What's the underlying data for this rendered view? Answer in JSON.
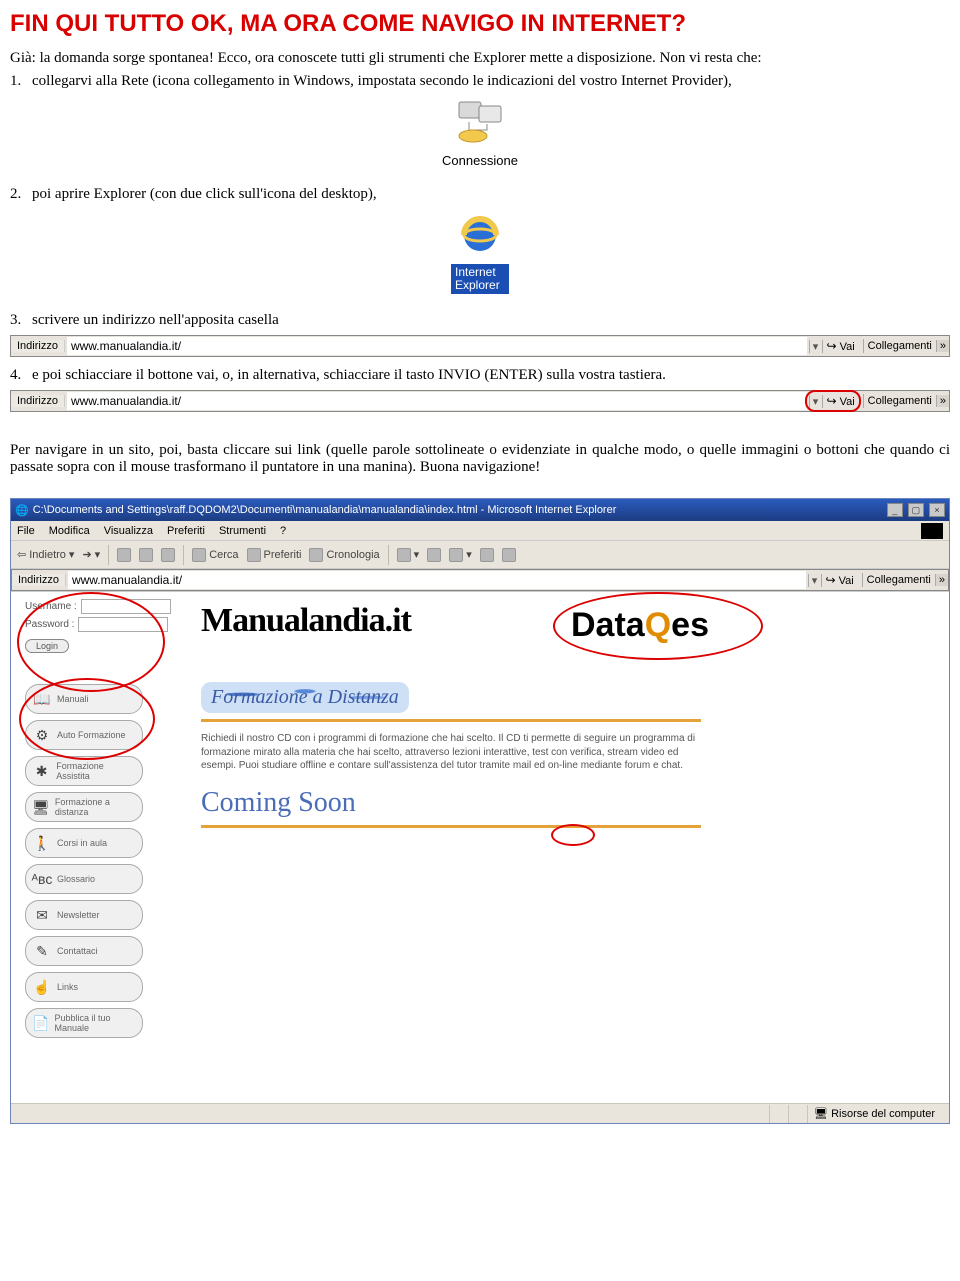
{
  "title": "FIN QUI TUTTO OK, MA ORA COME NAVIGO IN INTERNET?",
  "intro": "Già: la domanda sorge spontanea! Ecco, ora conoscete tutti gli strumenti che Explorer mette a disposizione. Non vi resta che:",
  "steps": {
    "n1": "1.",
    "s1": "collegarvi alla Rete (icona collegamento in Windows, impostata secondo le indicazioni del vostro Internet Provider),",
    "n2": "2.",
    "s2": "poi aprire Explorer (con due click sull'icona del desktop),",
    "n3": "3.",
    "s3": "scrivere un indirizzo nell'apposita casella",
    "n4": "4.",
    "s4": "e poi schiacciare il bottone vai, o, in alternativa, schiacciare il tasto INVIO (ENTER) sulla vostra tastiera."
  },
  "connection_label": "Connessione",
  "ie_label_1": "Internet",
  "ie_label_2": "Explorer",
  "addressbar": {
    "label": "Indirizzo",
    "url": "www.manualandia.it/",
    "vai": "Vai",
    "collegamenti": "Collegamenti",
    "chev": "»"
  },
  "closing": "Per navigare in un sito, poi, basta cliccare sui link (quelle parole sottolineate o evidenziate in qualche modo, o quelle immagini o bottoni che quando ci passate sopra con il mouse trasformano il puntatore in una manina). Buona navigazione!",
  "browser": {
    "title": "C:\\Documents and Settings\\raff.DQDOM2\\Documenti\\manualandia\\manualandia\\index.html - Microsoft Internet Explorer",
    "menu": [
      "File",
      "Modifica",
      "Visualizza",
      "Preferiti",
      "Strumenti",
      "?"
    ],
    "toolbar": {
      "indietro": "Indietro",
      "cerca": "Cerca",
      "preferiti": "Preferiti",
      "cronologia": "Cronologia"
    },
    "login": {
      "username": "Username :",
      "password": "Password :",
      "button": "Login"
    },
    "logo": "Manualandia.it",
    "dataq": {
      "p1": "Data",
      "q": "Q",
      "p2": "es"
    },
    "nav": [
      "Manuali",
      "Auto Formazione",
      "Formazione Assistita",
      "Formazione a distanza",
      "Corsi in aula",
      "Glossario",
      "Newsletter",
      "Contattaci",
      "Links",
      "Pubblica il tuo Manuale"
    ],
    "fmz": "Formazione a Distanza",
    "desc": "Richiedi il nostro CD con i programmi di formazione che hai scelto. Il CD ti permette di seguire un programma di formazione mirato alla materia che hai scelto, attraverso lezioni interattive, test con verifica, stream video ed esempi. Puoi studiare offline e contare sull'assistenza del tutor tramite mail ed on-line mediante forum e chat.",
    "coming": "Coming Soon",
    "status": "Risorse del computer"
  },
  "nav_icons": [
    "📖",
    "⚙",
    "✱",
    "🖥",
    "🚶",
    "ᴬʙᴄ",
    "✉",
    "✎",
    "☝",
    "📄"
  ]
}
